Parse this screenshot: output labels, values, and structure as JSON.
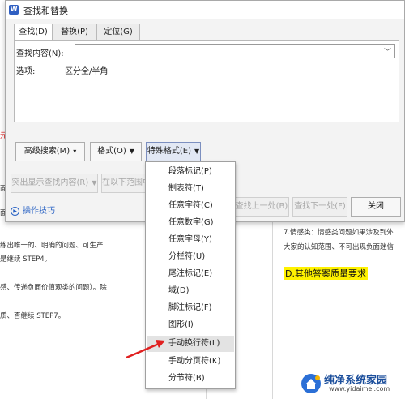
{
  "dialog": {
    "title": "查找和替换",
    "app_icon": "W",
    "tabs": [
      "查找(D)",
      "替换(P)",
      "定位(G)"
    ],
    "find_label": "查找内容(N):",
    "find_value": "",
    "options_label": "选项:",
    "options_value": "区分全/半角",
    "buttons": {
      "advanced_search": "高级搜索(M)",
      "format": "格式(O)",
      "special_format": "特殊格式(E)",
      "highlight": "突出显示查找内容(R)",
      "find_in": "在以下范围中",
      "find_prev": "查找上一处(B)",
      "find_next": "查找下一处(F)",
      "close": "关闭"
    },
    "tips": "操作技巧"
  },
  "special_format_menu": {
    "items": [
      "段落标记(P)",
      "制表符(T)",
      "任意字符(C)",
      "任意数字(G)",
      "任意字母(Y)",
      "分栏符(U)",
      "尾注标记(E)",
      "域(D)",
      "脚注标记(F)",
      "图形(I)",
      "手动换行符(L)",
      "手动分页符(K)",
      "分节符(B)"
    ],
    "highlighted": "手动换行符(L)"
  },
  "document": {
    "left_lines": [
      "练出唯一的、明确的问题、可生产",
      "是继续 STEP4。",
      "感、传递负面价值观类的问题）。除",
      "质、否继续 STEP7。"
    ],
    "left_fragments": [
      "面",
      "面"
    ],
    "right_lines": [
      "7.情感类：情感类问题如果涉及到外",
      "大家的认知范围、不可出现负面迷信"
    ],
    "highlight_text": "D.其他答案质量要求",
    "red_fragment": "元"
  },
  "watermark": {
    "text": "纯净系统家园",
    "url": "www.yidaimei.com"
  },
  "colors": {
    "accent": "#2f5fc2",
    "highlight_yellow": "#fff200",
    "arrow": "#e02020"
  }
}
